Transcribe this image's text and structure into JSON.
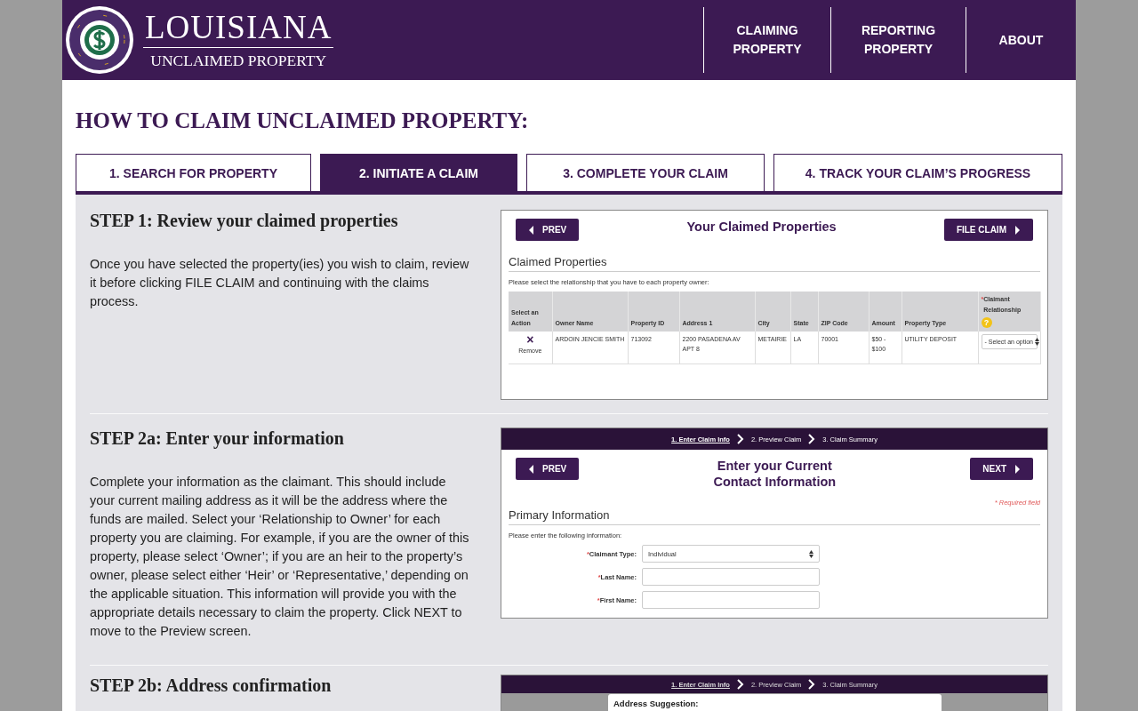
{
  "header": {
    "brand": {
      "title": "LOUISIANA",
      "subtitle": "UNCLAIMED PROPERTY"
    },
    "nav": [
      {
        "label": "CLAIMING PROPERTY"
      },
      {
        "label": "REPORTING PROPERTY"
      },
      {
        "label": "ABOUT"
      }
    ]
  },
  "page_title": "HOW TO CLAIM UNCLAIMED PROPERTY:",
  "tabs": [
    {
      "label": "1. SEARCH FOR PROPERTY",
      "selected": false
    },
    {
      "label": "2. INITIATE A CLAIM",
      "selected": true
    },
    {
      "label": "3. COMPLETE YOUR CLAIM",
      "selected": false
    },
    {
      "label": "4. TRACK YOUR CLAIM’S PROGRESS",
      "selected": false
    }
  ],
  "steps": [
    {
      "title": "STEP 1: Review your claimed properties",
      "text": "Once you have selected the property(ies) you wish to claim, review it before clicking FILE CLAIM and continuing with the claims process.",
      "screenshot": {
        "kind": "claimed_properties",
        "prev": "PREV",
        "heading": "Your Claimed Properties",
        "next": "FILE CLAIM",
        "section": "Claimed Properties",
        "instruction": "Please select the relationship that you have to each property owner:",
        "columns": [
          {
            "label": "Select an Action"
          },
          {
            "label": "Owner Name"
          },
          {
            "label": "Property ID"
          },
          {
            "label": "Address 1"
          },
          {
            "label": "City"
          },
          {
            "label": "State"
          },
          {
            "label": "ZIP Code"
          },
          {
            "label": "Amount"
          },
          {
            "label": "Property Type"
          },
          {
            "label": "Claimant Relationship",
            "marker": "*",
            "help": "?"
          }
        ],
        "rows": [
          {
            "cells": [
              {
                "kind": "action",
                "icon": "×",
                "text": "Remove"
              },
              {
                "kind": "text",
                "text": "ARDOIN JENCIE SMITH"
              },
              {
                "kind": "text",
                "text": "713092"
              },
              {
                "kind": "text",
                "text": "2200 PASADENA AV APT 8"
              },
              {
                "kind": "text",
                "text": "METAIRIE"
              },
              {
                "kind": "text",
                "text": "LA"
              },
              {
                "kind": "text",
                "text": "70001"
              },
              {
                "kind": "text",
                "text": "$50 - $100"
              },
              {
                "kind": "text",
                "text": "UTILITY DEPOSIT"
              },
              {
                "kind": "select",
                "text": "- Select an option"
              }
            ]
          }
        ]
      }
    },
    {
      "title": "STEP 2a: Enter your information",
      "text": "Complete your information as the claimant. This should include your current mailing address as it will be the address where the funds are mailed. Select your ‘Relationship to Owner’ for each property you are claiming. For example, if you are the owner of this property, please select ‘Owner’; if you are an heir to the property’s owner, please select either ‘Heir’ or ‘Representative,’ depending on the applicable situation. This information will provide you with the appropriate details necessary to claim the property. Click NEXT to move to the Preview screen.",
      "screenshot": {
        "kind": "contact_info",
        "progress": [
          {
            "label": "1. Enter Claim Info",
            "selected": true
          },
          {
            "label": "2. Preview Claim",
            "selected": false
          },
          {
            "label": "3. Claim Summary",
            "selected": false
          }
        ],
        "prev": "PREV",
        "heading": "Enter your Current Contact Information",
        "next": "NEXT",
        "required_note": "* Required field",
        "section": "Primary Information",
        "instruction": "Please enter the following information:",
        "fields": [
          {
            "label": "Claimant Type:",
            "marker": "*",
            "kind": "select",
            "value": "Individual"
          },
          {
            "label": "Last Name:",
            "marker": "*",
            "kind": "text"
          },
          {
            "label": "First Name:",
            "marker": "*",
            "kind": "text"
          }
        ]
      }
    },
    {
      "title": "STEP 2b: Address confirmation",
      "screenshot": {
        "kind": "address_confirmation",
        "progress": [
          {
            "label": "1. Enter Claim Info",
            "selected": true
          },
          {
            "label": "2. Preview Claim",
            "selected": false
          },
          {
            "label": "3. Claim Summary",
            "selected": false
          }
        ],
        "dialog_title": "Address Suggestion:"
      }
    }
  ]
}
